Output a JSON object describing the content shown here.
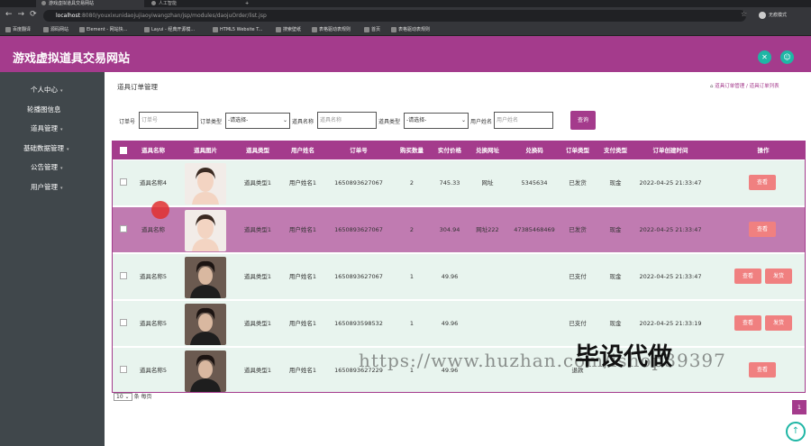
{
  "browser": {
    "tabs": [
      {
        "label": "游戏虚拟道具交易网站",
        "active": true
      },
      {
        "label": "人工智能",
        "active": false
      }
    ],
    "url_host": "localhost",
    "url_path": ":8080/youxixunidaojujiaoyiwangzhan/jsp/modules/daojuOrder/list.jsp",
    "profile_label": "无痕模式",
    "bookmarks": [
      "百度翻译",
      "源码网站",
      "Element - 网站快...",
      "Layui - 经典开源模...",
      "HTML5 Website T...",
      "搜索壁纸",
      "表格驱动表规则",
      "首页",
      "表格驱动表规则"
    ]
  },
  "header": {
    "title": "游戏虚拟道具交易网站"
  },
  "sidebar": {
    "items": [
      {
        "label": "个人中心"
      },
      {
        "label": "轮播图信息"
      },
      {
        "label": "道具管理"
      },
      {
        "label": "基础数据管理"
      },
      {
        "label": "公告管理"
      },
      {
        "label": "用户管理"
      }
    ]
  },
  "page": {
    "title": "道具订单管理",
    "breadcrumb": [
      "道具订单管理",
      "道具订单列表"
    ]
  },
  "filters": {
    "order_no_label": "订单号",
    "order_no_placeholder": "订单号",
    "order_type_label": "订单类型",
    "order_type_value": "-请选择-",
    "item_name_label": "道具名称",
    "item_name_placeholder": "道具名称",
    "item_type_label": "道具类型",
    "item_type_value": "-请选择-",
    "user_name_label": "用户姓名",
    "user_name_placeholder": "用户姓名",
    "search_button": "查询"
  },
  "table": {
    "columns": [
      "道具名称",
      "道具图片",
      "道具类型",
      "用户姓名",
      "订单号",
      "购买数量",
      "实付价格",
      "兑换网址",
      "兑换码",
      "订单类型",
      "支付类型",
      "订单创建时间",
      "操作"
    ],
    "rows": [
      {
        "item_name": "道具名称4",
        "item_type": "道具类型1",
        "user_name": "用户姓名1",
        "order_no": "1650893627067",
        "qty": "2",
        "price": "745.33",
        "url": "网址",
        "code": "5345634",
        "order_type": "已发货",
        "pay_type": "现金",
        "created": "2022-04-25 21:33:47",
        "actions": [
          "查看"
        ]
      },
      {
        "item_name": "道具名称",
        "item_type": "道具类型1",
        "user_name": "用户姓名1",
        "order_no": "1650893627067",
        "qty": "2",
        "price": "304.94",
        "url": "网址222",
        "code": "47385468469",
        "order_type": "已发货",
        "pay_type": "现金",
        "created": "2022-04-25 21:33:47",
        "actions": [
          "查看"
        ]
      },
      {
        "item_name": "道具名称5",
        "item_type": "道具类型1",
        "user_name": "用户姓名1",
        "order_no": "1650893627067",
        "qty": "1",
        "price": "49.96",
        "url": "",
        "code": "",
        "order_type": "已支付",
        "pay_type": "现金",
        "created": "2022-04-25 21:33:47",
        "actions": [
          "查看",
          "发货"
        ]
      },
      {
        "item_name": "道具名称5",
        "item_type": "道具类型1",
        "user_name": "用户姓名1",
        "order_no": "1650893598532",
        "qty": "1",
        "price": "49.96",
        "url": "",
        "code": "",
        "order_type": "已支付",
        "pay_type": "现金",
        "created": "2022-04-25 21:33:19",
        "actions": [
          "查看",
          "发货"
        ]
      },
      {
        "item_name": "道具名称5",
        "item_type": "道具类型1",
        "user_name": "用户姓名1",
        "order_no": "1650893627229",
        "qty": "1",
        "price": "49.96",
        "url": "",
        "code": "",
        "order_type": "退款",
        "pay_type": "",
        "created": "",
        "actions": [
          "查看"
        ]
      }
    ]
  },
  "pagination": {
    "page_size": "10",
    "per_page_label": "条 每页",
    "current_page": "1"
  },
  "overlay": {
    "watermark_url": "https://www.huzhan.com/ishop39397",
    "watermark_text": "毕设代做"
  },
  "colors": {
    "brand": "#a43b8c",
    "accent": "#1fb6a5",
    "sidebar": "#40474b",
    "action_button": "#f08080"
  }
}
